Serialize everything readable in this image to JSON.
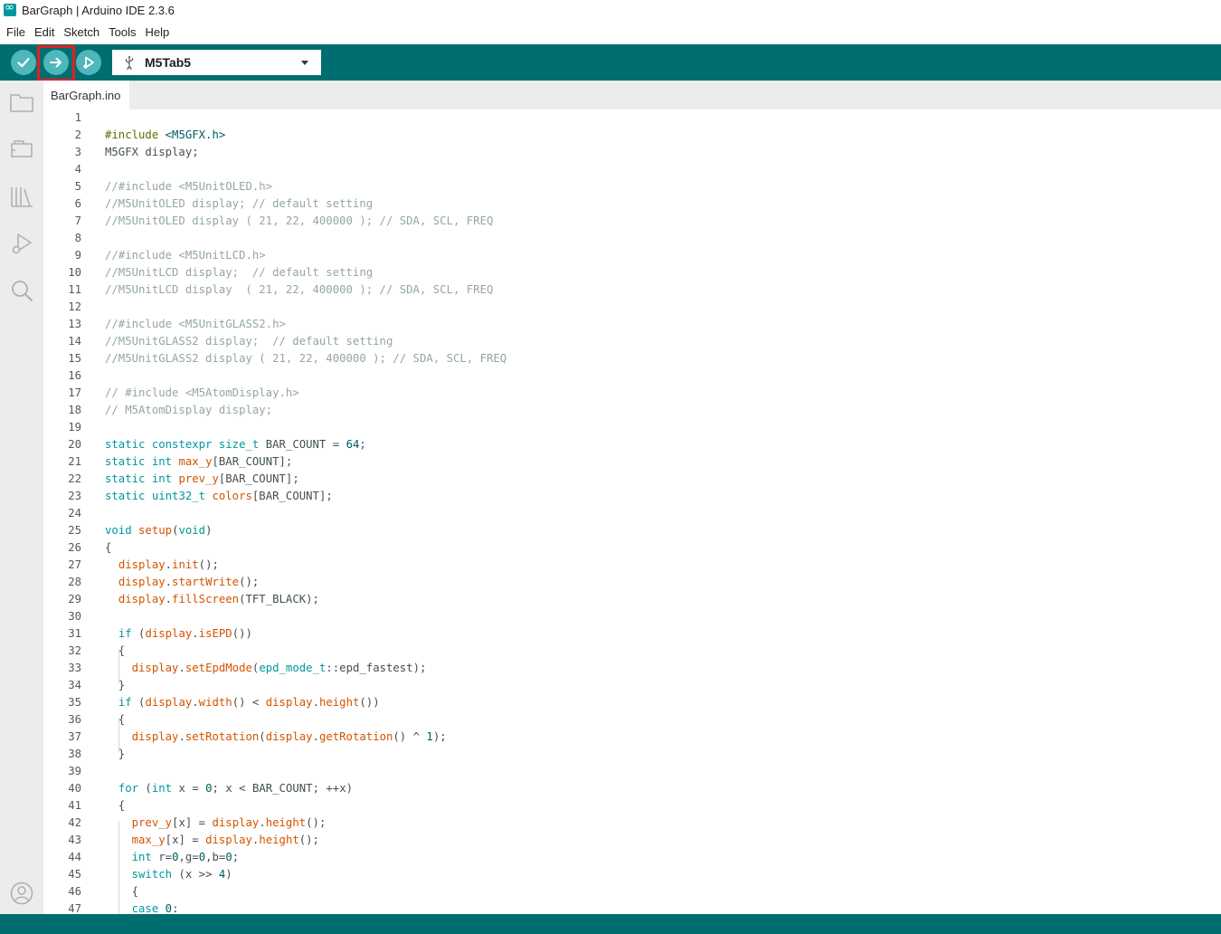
{
  "window": {
    "title": "BarGraph | Arduino IDE 2.3.6"
  },
  "menu": [
    "File",
    "Edit",
    "Sketch",
    "Tools",
    "Help"
  ],
  "toolbar": {
    "verify_icon": "check-icon",
    "upload_icon": "arrow-right-icon",
    "debug_icon": "debug-icon",
    "board": "M5Tab5",
    "accent": "#006d70",
    "highlight_color": "#e21f26"
  },
  "sidebar": [
    "folder-icon",
    "board-manager-icon",
    "library-icon",
    "debug-icon",
    "search-icon",
    "account-icon"
  ],
  "tab": {
    "label": "BarGraph.ino"
  },
  "editor": {
    "lines": [
      "",
      "#include <M5GFX.h>",
      "M5GFX display;",
      "",
      "//#include <M5UnitOLED.h>",
      "//M5UnitOLED display; // default setting",
      "//M5UnitOLED display ( 21, 22, 400000 ); // SDA, SCL, FREQ",
      "",
      "//#include <M5UnitLCD.h>",
      "//M5UnitLCD display;  // default setting",
      "//M5UnitLCD display  ( 21, 22, 400000 ); // SDA, SCL, FREQ",
      "",
      "//#include <M5UnitGLASS2.h>",
      "//M5UnitGLASS2 display;  // default setting",
      "//M5UnitGLASS2 display ( 21, 22, 400000 ); // SDA, SCL, FREQ",
      "",
      "// #include <M5AtomDisplay.h>",
      "// M5AtomDisplay display;",
      "",
      "static constexpr size_t BAR_COUNT = 64;",
      "static int max_y[BAR_COUNT];",
      "static int prev_y[BAR_COUNT];",
      "static uint32_t colors[BAR_COUNT];",
      "",
      "void setup(void)",
      "{",
      "  display.init();",
      "  display.startWrite();",
      "  display.fillScreen(TFT_BLACK);",
      "",
      "  if (display.isEPD())",
      "  {",
      "    display.setEpdMode(epd_mode_t::epd_fastest);",
      "  }",
      "  if (display.width() < display.height())",
      "  {",
      "    display.setRotation(display.getRotation() ^ 1);",
      "  }",
      "",
      "  for (int x = 0; x < BAR_COUNT; ++x)",
      "  {",
      "    prev_y[x] = display.height();",
      "    max_y[x] = display.height();",
      "    int r=0,g=0,b=0;",
      "    switch (x >> 4)",
      "    {",
      "    case 0:"
    ]
  }
}
